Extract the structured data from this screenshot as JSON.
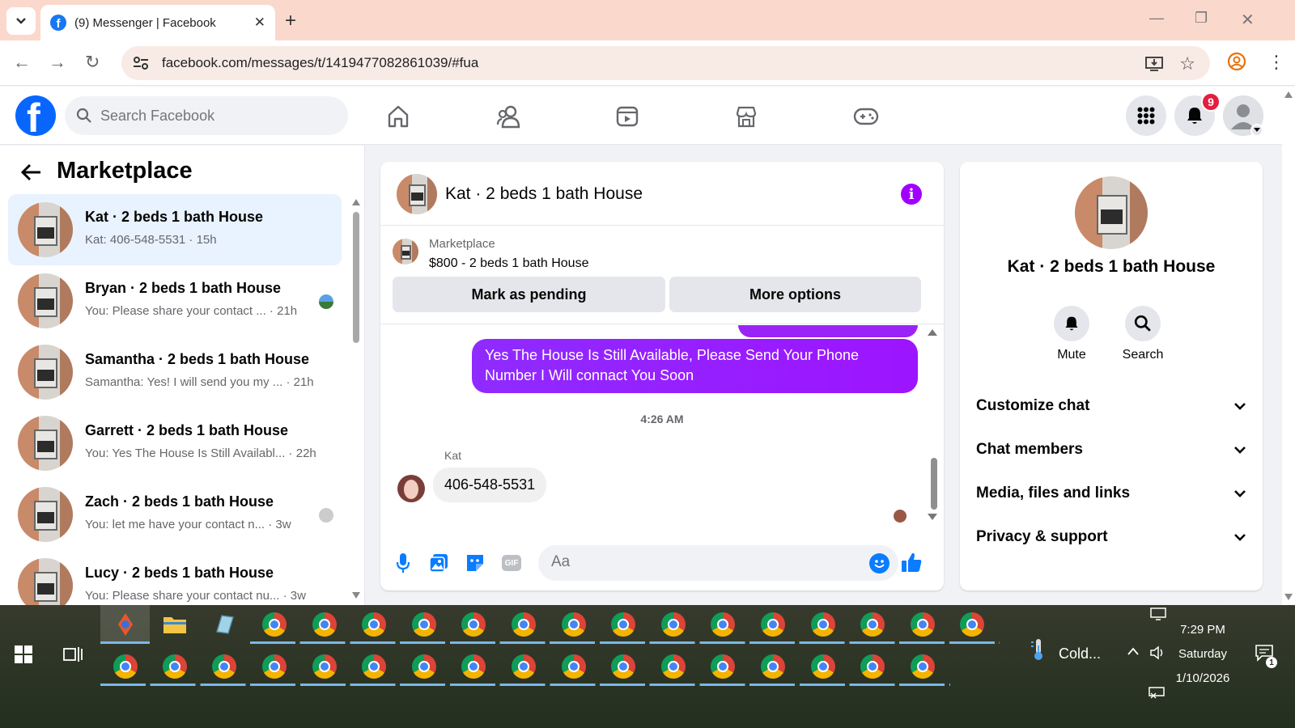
{
  "browser": {
    "tab_title": "(9) Messenger | Facebook",
    "url": "facebook.com/messages/t/1419477082861039/#fua"
  },
  "fb": {
    "search_placeholder": "Search Facebook",
    "notification_count": "9"
  },
  "left": {
    "title": "Marketplace",
    "conversations": [
      {
        "name": "Kat · 2 beds 1 bath House",
        "preview": "Kat: 406-548-5531 · 15h",
        "active": true
      },
      {
        "name": "Bryan · 2 beds 1 bath House",
        "preview": "You: Please share your contact ... · 21h"
      },
      {
        "name": "Samantha · 2 beds 1 bath House",
        "preview": "Samantha: Yes! I will send you my ... · 21h"
      },
      {
        "name": "Garrett · 2 beds 1 bath House",
        "preview": "You: Yes The House Is Still Availabl... · 22h"
      },
      {
        "name": "Zach · 2 beds 1 bath House",
        "preview": "You: let me have your contact n... · 3w"
      },
      {
        "name": "Lucy · 2 beds 1 bath House",
        "preview": "You: Please share your contact nu... · 3w"
      }
    ]
  },
  "chat": {
    "title": "Kat · 2 beds 1 bath House",
    "listing_source": "Marketplace",
    "listing_price": "$800 - 2 beds 1 bath House",
    "mark_pending_label": "Mark as pending",
    "more_options_label": "More options",
    "sent_message": "Yes The House Is Still Available, Please Send Your Phone Number I Will connact You Soon",
    "timestamp": "4:26 AM",
    "sender": "Kat",
    "received_message": "406-548-5531",
    "input_placeholder": "Aa"
  },
  "info": {
    "name": "Kat · 2 beds 1 bath House",
    "mute_label": "Mute",
    "search_label": "Search",
    "rows": [
      "Customize chat",
      "Chat members",
      "Media, files and links",
      "Privacy & support"
    ]
  },
  "taskbar": {
    "weather": "Cold...",
    "time": "7:29 PM",
    "day": "Saturday",
    "date": "1/10/2026",
    "notification_count": "1"
  },
  "colors": {
    "fb_blue": "#0866ff",
    "messenger_purple": "#9d14ff",
    "active_conv": "#e9f2ff",
    "badge_red": "#e41e3f"
  }
}
